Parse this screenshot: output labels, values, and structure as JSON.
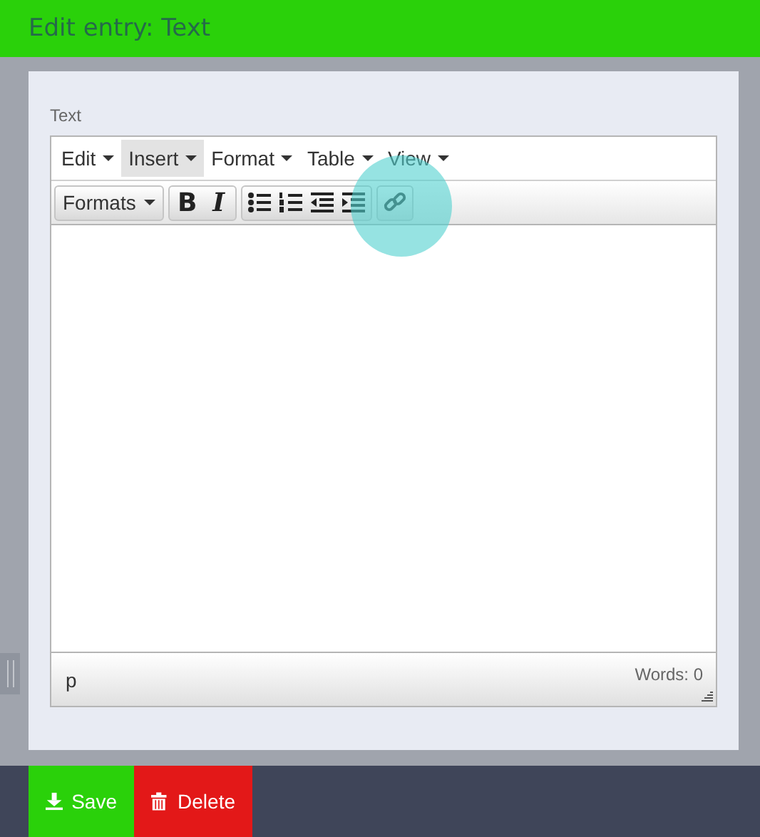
{
  "header": {
    "title": "Edit entry: Text"
  },
  "field": {
    "label": "Text"
  },
  "menus": [
    {
      "label": "Edit",
      "selected": false
    },
    {
      "label": "Insert",
      "selected": true
    },
    {
      "label": "Format",
      "selected": false
    },
    {
      "label": "Table",
      "selected": false
    },
    {
      "label": "View",
      "selected": false
    }
  ],
  "toolbar": {
    "formats": "Formats",
    "groups": [
      {
        "items": [
          {
            "kind": "bold",
            "label": "B"
          },
          {
            "kind": "italic",
            "label": "I"
          }
        ]
      },
      {
        "items": [
          {
            "kind": "bullet-list"
          },
          {
            "kind": "numbered-list"
          },
          {
            "kind": "outdent"
          },
          {
            "kind": "indent"
          }
        ]
      },
      {
        "items": [
          {
            "kind": "link"
          }
        ]
      }
    ]
  },
  "status_bar": {
    "path": "p",
    "word_count": "Words: 0"
  },
  "buttons": [
    {
      "kind": "save",
      "label": "Save"
    },
    {
      "kind": "delete",
      "label": "Delete"
    }
  ]
}
